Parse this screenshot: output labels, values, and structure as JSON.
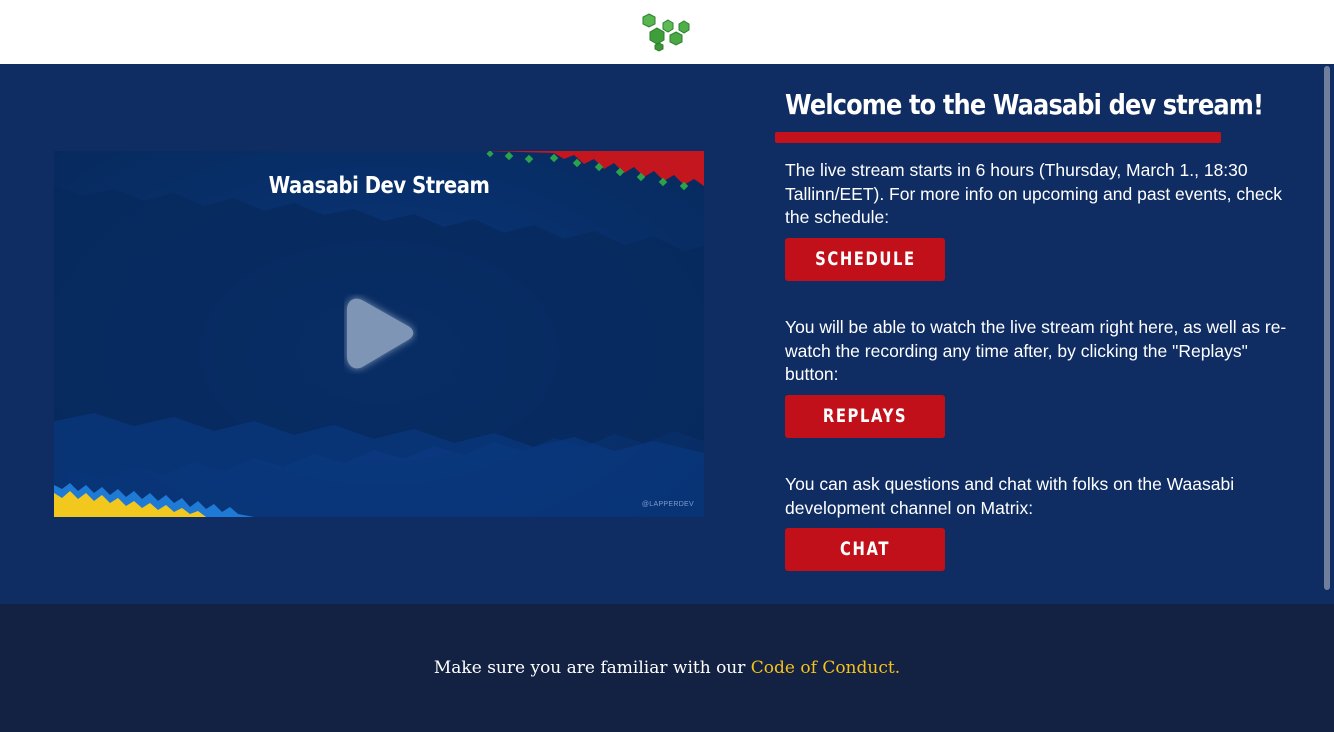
{
  "header": {
    "logo_icon": "green-hexagon-cluster-icon"
  },
  "video": {
    "title": "Waasabi Dev Stream",
    "watermark": "@LAPPERDEV",
    "play_icon": "play-icon"
  },
  "welcome": {
    "title": "Welcome to the Waasabi dev stream!",
    "schedule_text": "The live stream starts in 6 hours (Thursday, March 1., 18:30 Tallinn/EET). For more info on upcoming and past events, check the schedule:",
    "schedule_button": "SCHEDULE",
    "replays_text": "You will be able to watch the live stream right here, as well as re-watch the recording any time after, by clicking the \"Replays\" button:",
    "replays_button": "REPLAYS",
    "chat_text": "You can ask questions and chat with folks on the Waasabi development channel on Matrix:",
    "chat_button": "CHAT"
  },
  "footer": {
    "text": "Make sure you are familiar with our ",
    "link": "Code of Conduct."
  },
  "colors": {
    "background": "#0f2d63",
    "accent_red": "#c2101a",
    "footer_bg": "#132143",
    "link_yellow": "#f5c21b"
  }
}
